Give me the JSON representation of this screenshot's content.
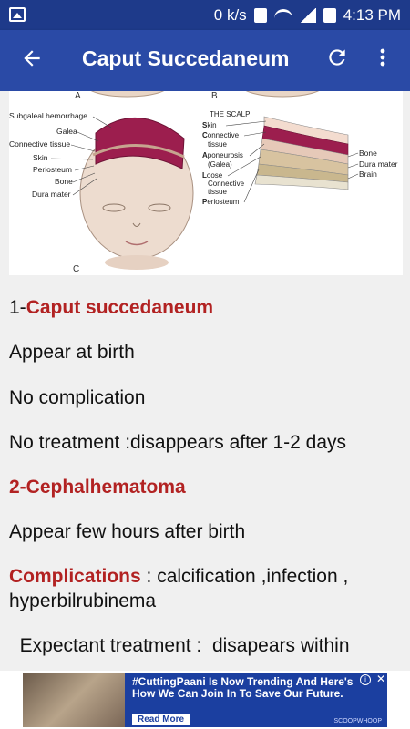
{
  "status_bar": {
    "net_speed": "0 k/s",
    "time": "4:13 PM"
  },
  "app_bar": {
    "title": "Caput Succedaneum"
  },
  "figure": {
    "panel_a": "A",
    "panel_b": "B",
    "panel_c": "C",
    "labels_left": [
      "Subgaleal hemorrhage",
      "Galea",
      "Connective tissue",
      "Skin",
      "Periosteum",
      "Bone",
      "Dura mater"
    ],
    "scalp_title": "THE SCALP",
    "scalp_labels": {
      "skin_letter": "S",
      "skin_rest": "kin",
      "connective_letter": "C",
      "connective_rest": "onnective",
      "connective_2": "tissue",
      "aponeurosis_letter": "A",
      "aponeurosis_rest": "poneurosis",
      "galea": "(Galea)",
      "loose_letter": "L",
      "loose_rest": "oose",
      "loose_2": "Connective",
      "loose_3": "tissue",
      "periosteum_letter": "P",
      "periosteum_rest": "eriosteum"
    },
    "labels_right": [
      "Bone",
      "Dura mater",
      "Brain"
    ]
  },
  "content": {
    "item1_prefix": "1-",
    "item1_title": "Caput succedaneum",
    "item1_line1": "Appear at birth",
    "item1_line2": "No complication",
    "item1_line3": "No treatment :disappears after 1-2 days",
    "item2_title": "2-Cephalhematoma",
    "item2_line1": "Appear few hours after birth",
    "complications_label": "Complications",
    "complications_text": " : calcification ,infection ,",
    "complications_text2": "hyperbilrubinema",
    "expectant_text": "  Expectant treatment :  disapears within"
  },
  "ad": {
    "line1": "#CuttingPaani Is Now Trending And Here's",
    "line2": "How We Can Join In To Save Our Future.",
    "button": "Read More",
    "brand": "SCOOPWHOOP"
  }
}
